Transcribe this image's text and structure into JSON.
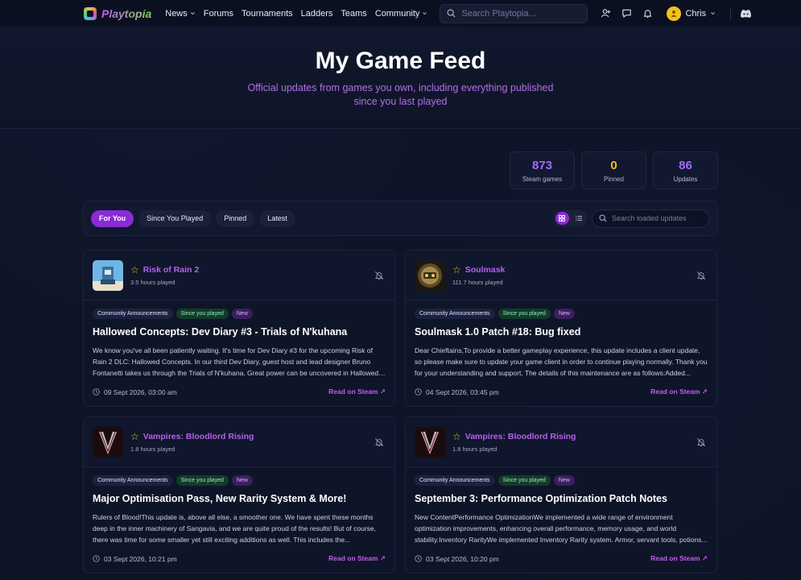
{
  "nav": {
    "brand": "Playtopia",
    "links": [
      {
        "label": "News",
        "dropdown": true
      },
      {
        "label": "Forums",
        "dropdown": false
      },
      {
        "label": "Tournaments",
        "dropdown": false
      },
      {
        "label": "Ladders",
        "dropdown": false
      },
      {
        "label": "Teams",
        "dropdown": false
      },
      {
        "label": "Community",
        "dropdown": true
      }
    ],
    "search_placeholder": "Search Playtopia...",
    "icons": [
      "add-friend-icon",
      "messages-icon",
      "notifications-icon"
    ],
    "user": {
      "name": "Chris"
    },
    "discord_icon": "discord-icon"
  },
  "hero": {
    "title": "My Game Feed",
    "subtitle": "Official updates from games you own, including everything published since you last played"
  },
  "stats": [
    {
      "value": "873",
      "label": "Steam games",
      "color": "#a46cf5"
    },
    {
      "value": "0",
      "label": "Pinned",
      "color": "#f2c21b"
    },
    {
      "value": "86",
      "label": "Updates",
      "color": "#a46cf5"
    }
  ],
  "filters": {
    "tabs": [
      "For You",
      "Since You Played",
      "Pinned",
      "Latest"
    ],
    "active_tab": "For You",
    "view_modes": [
      "grid-view-icon",
      "list-view-icon"
    ],
    "search_placeholder": "Search loaded updates"
  },
  "cards": [
    {
      "game": "Risk of Rain 2",
      "played": "3.5 hours played",
      "chips": [
        "Community Announcements",
        "Since you played",
        "New"
      ],
      "title": "Hallowed Concepts: Dev Diary #3 - Trials of N'kuhana",
      "excerpt": "We know you've all been patiently waiting. It's time for Dev Diary #3 for the upcoming Risk of Rain 2 DLC: Hallowed Concepts. In our third Dev Diary, guest host and lead designer Bruno Fontanetti takes us through the Trials of N'kuhana. Great power can be uncovered in Hallowed Concepts...",
      "date": "09 Sept 2026, 03:00 am",
      "cta": "Read on Steam ↗"
    },
    {
      "game": "Soulmask",
      "played": "111.7 hours played",
      "chips": [
        "Community Announcements",
        "Since you played",
        "New"
      ],
      "title": "Soulmask 1.0 Patch #18: Bug fixed",
      "excerpt": "Dear Chieftains,To provide a better gameplay experience, this update includes a client update, so please make sure to update your game client in order to continue playing normally. Thank you for your understanding and support. The details of this maintenance are as follows:Added...",
      "date": "04 Sept 2026, 03:45 pm",
      "cta": "Read on Steam ↗"
    },
    {
      "game": "Vampires: Bloodlord Rising",
      "played": "1.8 hours played",
      "chips": [
        "Community Announcements",
        "Since you played",
        "New"
      ],
      "title": "Major Optimisation Pass, New Rarity System & More!",
      "excerpt": "Rulers of Blood!This update is, above all else, a smoother one. We have spent these months deep in the inner machinery of Sangavia, and we are quite proud of the results! But of course, there was time for some smaller yet still exciting additions as well. This includes the...",
      "date": "03 Sept 2026, 10:21 pm",
      "cta": "Read on Steam ↗"
    },
    {
      "game": "Vampires: Bloodlord Rising",
      "played": "1.8 hours played",
      "chips": [
        "Community Announcements",
        "Since you played",
        "New"
      ],
      "title": "September 3: Performance Optimization Patch Notes",
      "excerpt": "New ContentPerformance OptimizationWe implemented a wide range of environment optimization improvements, enhancing overall performance, memory usage, and world stability.Inventory RarityWe implemented Inventory Rarity system. Armor, servant tools, potions...",
      "date": "03 Sept 2026, 10:20 pm",
      "cta": "Read on Steam ↗"
    }
  ]
}
